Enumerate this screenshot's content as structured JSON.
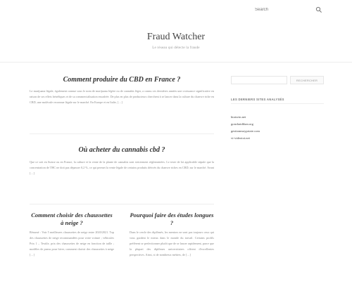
{
  "header": {
    "search_placeholder": "Search",
    "site_title": "Fraud Watcher",
    "site_description": "Le réseau qui détecte la fraude"
  },
  "posts": [
    {
      "title": "Comment produire du CBD en France ?",
      "excerpt": "Le marijuana légale, également connue sous le nom de marijuana légère ou de cannabis léger, a connu ces dernières années une croissance significative en raison de ses effets bénéfiques et de sa commercialisation encadrée. De plus en plus de producteurs cherchent à se lancer dans la culture du chanvre riche en CBD, une molécule reconnue légale sur le marché. En Europe et en Italie, […]"
    },
    {
      "title": "Où acheter du cannabis cbd ?",
      "excerpt": "Que ce soit en Suisse ou en France, la culture et la vente de la plante de cannabis sont strictement réglementées. Le texte de loi applicable stipule que la concentration de THC ne doit pas dépasser 0,2 %, ce qui permet la vente légale de certains produits dérivés du chanvre riches en CBD, sur le marché. Avant […]"
    },
    {
      "title": "Comment choisir des chaussettes à neige ?",
      "excerpt": "Résumé : Voir 5 meilleures chaussettes de neige entre 2020/2021. Top des chaussettes de neige recommandées pour votre voiture ; véhicules Prix 1 – Textile, prix des chaussettes de neige en fonction de taille ; modèles de pneus pour hiver, comment choisir des chaussettes à neige […]"
    },
    {
      "title": "Pourquoi faire des études longues ?",
      "excerpt": "Dans le cercle des diplômés, les mentors ne sont pas toujours ceux qui vous guident le mieux dans le monde du travail. Certains profils préfèrent se perfectionner plutôt que de se lancer rapidement, parce que la plupart des diplômes universitaires offrent d'excellentes perspectives. Ainsi, si de nombreux métiers, de […]"
    }
  ],
  "sidebar": {
    "search_placeholder": "",
    "search_button": "RECHERCHER",
    "widget_title": "LES DERNIERS SITES ANALYSÉS",
    "links": [
      "biaisvin.net",
      "gonchatdiban.org",
      "gestionmoypriate.com",
      "vi-videotoi.net"
    ]
  }
}
